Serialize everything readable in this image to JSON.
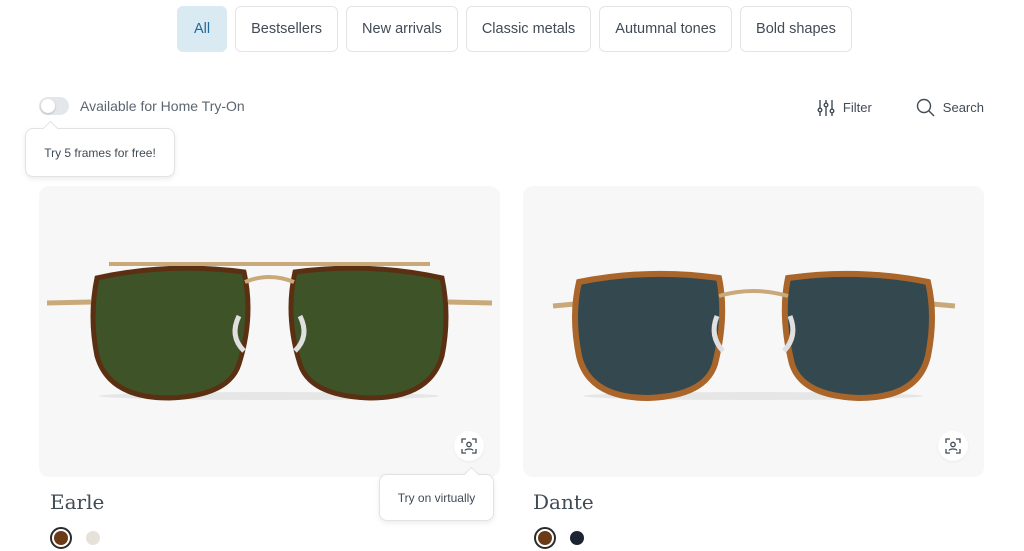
{
  "filters": {
    "chips": [
      {
        "label": "All",
        "active": true
      },
      {
        "label": "Bestsellers",
        "active": false
      },
      {
        "label": "New arrivals",
        "active": false
      },
      {
        "label": "Classic metals",
        "active": false
      },
      {
        "label": "Autumnal tones",
        "active": false
      },
      {
        "label": "Bold shapes",
        "active": false
      }
    ]
  },
  "toolbar": {
    "home_try_on_label": "Available for Home Try-On",
    "home_try_on_enabled": false,
    "try_tooltip": "Try 5 frames for free!",
    "filter_label": "Filter",
    "search_label": "Search"
  },
  "products": [
    {
      "name": "Earle",
      "lens_color": "#3e5428",
      "frame_color": "#5b2f12",
      "swatches": [
        {
          "color": "#6b3a16",
          "selected": true
        },
        {
          "color": "#e6e2da",
          "selected": false
        }
      ],
      "virtual_tooltip": "Try on virtually"
    },
    {
      "name": "Dante",
      "lens_color": "#33494f",
      "frame_color": "#a9652a",
      "swatches": [
        {
          "color": "#6b3a16",
          "selected": true
        },
        {
          "color": "#1c2433",
          "selected": false
        }
      ]
    }
  ],
  "colors": {
    "accent": "#1f6a99",
    "chip_active_bg": "#daeaf3"
  }
}
